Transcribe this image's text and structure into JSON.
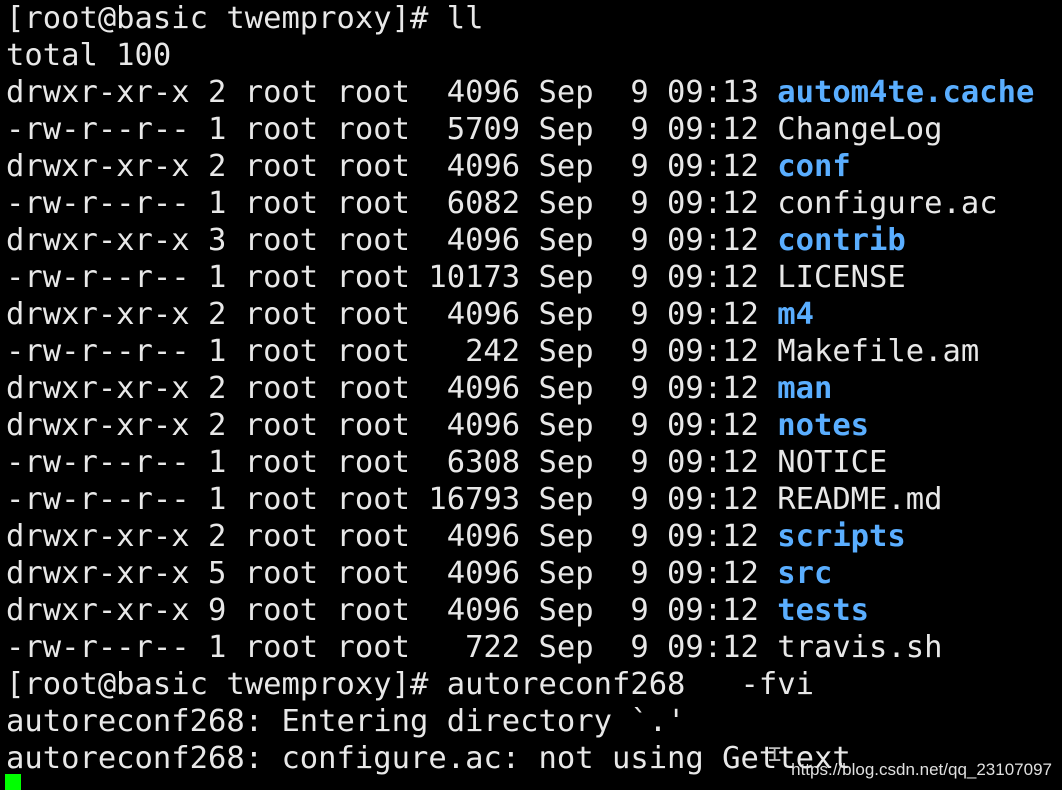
{
  "terminal": {
    "lines": [
      {
        "text": "[root@basic twemproxy]# ll"
      },
      {
        "text": "total 100"
      },
      {
        "prefix": "drwxr-xr-x 2 root root  4096 Sep  9 09:13 ",
        "name": "autom4te.cache",
        "is_dir": true
      },
      {
        "prefix": "-rw-r--r-- 1 root root  5709 Sep  9 09:12 ",
        "name": "ChangeLog",
        "is_dir": false
      },
      {
        "prefix": "drwxr-xr-x 2 root root  4096 Sep  9 09:12 ",
        "name": "conf",
        "is_dir": true
      },
      {
        "prefix": "-rw-r--r-- 1 root root  6082 Sep  9 09:12 ",
        "name": "configure.ac",
        "is_dir": false
      },
      {
        "prefix": "drwxr-xr-x 3 root root  4096 Sep  9 09:12 ",
        "name": "contrib",
        "is_dir": true
      },
      {
        "prefix": "-rw-r--r-- 1 root root 10173 Sep  9 09:12 ",
        "name": "LICENSE",
        "is_dir": false
      },
      {
        "prefix": "drwxr-xr-x 2 root root  4096 Sep  9 09:12 ",
        "name": "m4",
        "is_dir": true
      },
      {
        "prefix": "-rw-r--r-- 1 root root   242 Sep  9 09:12 ",
        "name": "Makefile.am",
        "is_dir": false
      },
      {
        "prefix": "drwxr-xr-x 2 root root  4096 Sep  9 09:12 ",
        "name": "man",
        "is_dir": true
      },
      {
        "prefix": "drwxr-xr-x 2 root root  4096 Sep  9 09:12 ",
        "name": "notes",
        "is_dir": true
      },
      {
        "prefix": "-rw-r--r-- 1 root root  6308 Sep  9 09:12 ",
        "name": "NOTICE",
        "is_dir": false
      },
      {
        "prefix": "-rw-r--r-- 1 root root 16793 Sep  9 09:12 ",
        "name": "README.md",
        "is_dir": false
      },
      {
        "prefix": "drwxr-xr-x 2 root root  4096 Sep  9 09:12 ",
        "name": "scripts",
        "is_dir": true
      },
      {
        "prefix": "drwxr-xr-x 5 root root  4096 Sep  9 09:12 ",
        "name": "src",
        "is_dir": true
      },
      {
        "prefix": "drwxr-xr-x 9 root root  4096 Sep  9 09:12 ",
        "name": "tests",
        "is_dir": true
      },
      {
        "prefix": "-rw-r--r-- 1 root root   722 Sep  9 09:12 ",
        "name": "travis.sh",
        "is_dir": false
      },
      {
        "text": "[root@basic twemproxy]# autoreconf268   -fvi"
      },
      {
        "text": "autoreconf268: Entering directory `.'"
      },
      {
        "text": "autoreconf268: configure.ac: not using Gettext"
      }
    ]
  },
  "watermark": "https://blog.csdn.net/qq_23107097",
  "colors": {
    "background": "#000000",
    "text": "#e8e8e8",
    "directory": "#5aaeff",
    "cursor": "#00ff00"
  },
  "icons": {
    "cursor": "block-cursor-icon",
    "mouse": "text-ibeam-pointer-icon"
  }
}
